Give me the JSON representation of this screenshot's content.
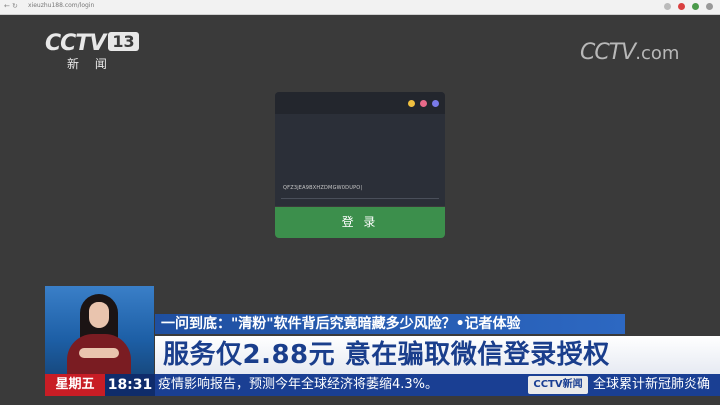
{
  "browser": {
    "url": "xieuzhu188.com/login",
    "back_icon": "back-arrow-icon",
    "forward_icon": "forward-arrow-icon",
    "reload_icon": "reload-icon"
  },
  "channel_logo": {
    "brand": "CCTV",
    "number": "13",
    "subtitle": "新 闻"
  },
  "corner_logo": {
    "brand": "CCTV",
    "suffix": ".com"
  },
  "login_card": {
    "token_text": "QFZ3jEA9BXHZDMGW0DUPO|",
    "login_label": "登 录",
    "dot_colors": [
      "#f0c040",
      "#e86a8a",
      "#7a7ae8"
    ],
    "button_color": "#3c8f4c"
  },
  "captions": {
    "line1": "一问到底：\"清粉\"软件背后究竟暗藏多少风险？•记者体验",
    "line2": "服务仅2.88元 意在骗取微信登录授权"
  },
  "ticker": {
    "weekday": "星期五",
    "time": "18:31",
    "news_left": "疫情影响报告，预测今年全球经济将萎缩4.3%。",
    "news_logo": "CCTV新闻",
    "news_right": "全球累计新冠肺炎确"
  },
  "colors": {
    "background": "#3a3a3a",
    "caption_blue": "#1f4fa0",
    "weekday_red": "#c81d25"
  }
}
